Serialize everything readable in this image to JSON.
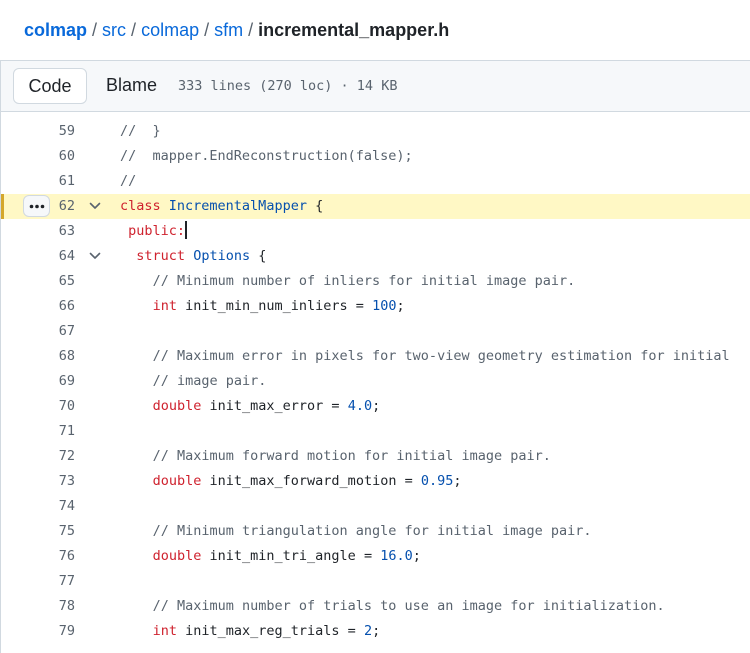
{
  "breadcrumb": {
    "repo": "colmap",
    "sep": "/",
    "parts": [
      "src",
      "colmap",
      "sfm"
    ],
    "file": "incremental_mapper.h"
  },
  "toolbar": {
    "code_label": "Code",
    "blame_label": "Blame",
    "file_info": "333 lines (270 loc) · 14 KB"
  },
  "icons": {
    "kebab": "kebab-horizontal-icon",
    "fold": "chevron-down-icon"
  },
  "colors": {
    "keyword": "#cf222e",
    "type": "#0550ae",
    "comment": "#59636e",
    "highlight": "#fff8c5",
    "link": "#0969da"
  },
  "code": {
    "highlighted_line": 62,
    "lines": [
      {
        "n": "59",
        "text": "//  }"
      },
      {
        "n": "60",
        "text": "//  mapper.EndReconstruction(false);"
      },
      {
        "n": "61",
        "text": "//"
      },
      {
        "n": "62",
        "kw": "class",
        "type": "IncrementalMapper",
        "rest": "{"
      },
      {
        "n": "63",
        "kw": "public:"
      },
      {
        "n": "64",
        "kw": "struct",
        "type": "Options",
        "rest": "{"
      },
      {
        "n": "65",
        "text": "// Minimum number of inliers for initial image pair."
      },
      {
        "n": "66",
        "kw": "int",
        "decl": "init_min_num_inliers = ",
        "num": "100",
        "end": ";"
      },
      {
        "n": "67"
      },
      {
        "n": "68",
        "text": "// Maximum error in pixels for two-view geometry estimation for initial"
      },
      {
        "n": "69",
        "text": "// image pair."
      },
      {
        "n": "70",
        "kw": "double",
        "decl": "init_max_error = ",
        "num": "4.0",
        "end": ";"
      },
      {
        "n": "71"
      },
      {
        "n": "72",
        "text": "// Maximum forward motion for initial image pair."
      },
      {
        "n": "73",
        "kw": "double",
        "decl": "init_max_forward_motion = ",
        "num": "0.95",
        "end": ";"
      },
      {
        "n": "74"
      },
      {
        "n": "75",
        "text": "// Minimum triangulation angle for initial image pair."
      },
      {
        "n": "76",
        "kw": "double",
        "decl": "init_min_tri_angle = ",
        "num": "16.0",
        "end": ";"
      },
      {
        "n": "77"
      },
      {
        "n": "78",
        "text": "// Maximum number of trials to use an image for initialization."
      },
      {
        "n": "79",
        "kw": "int",
        "decl": "init_max_reg_trials = ",
        "num": "2",
        "end": ";"
      }
    ]
  }
}
